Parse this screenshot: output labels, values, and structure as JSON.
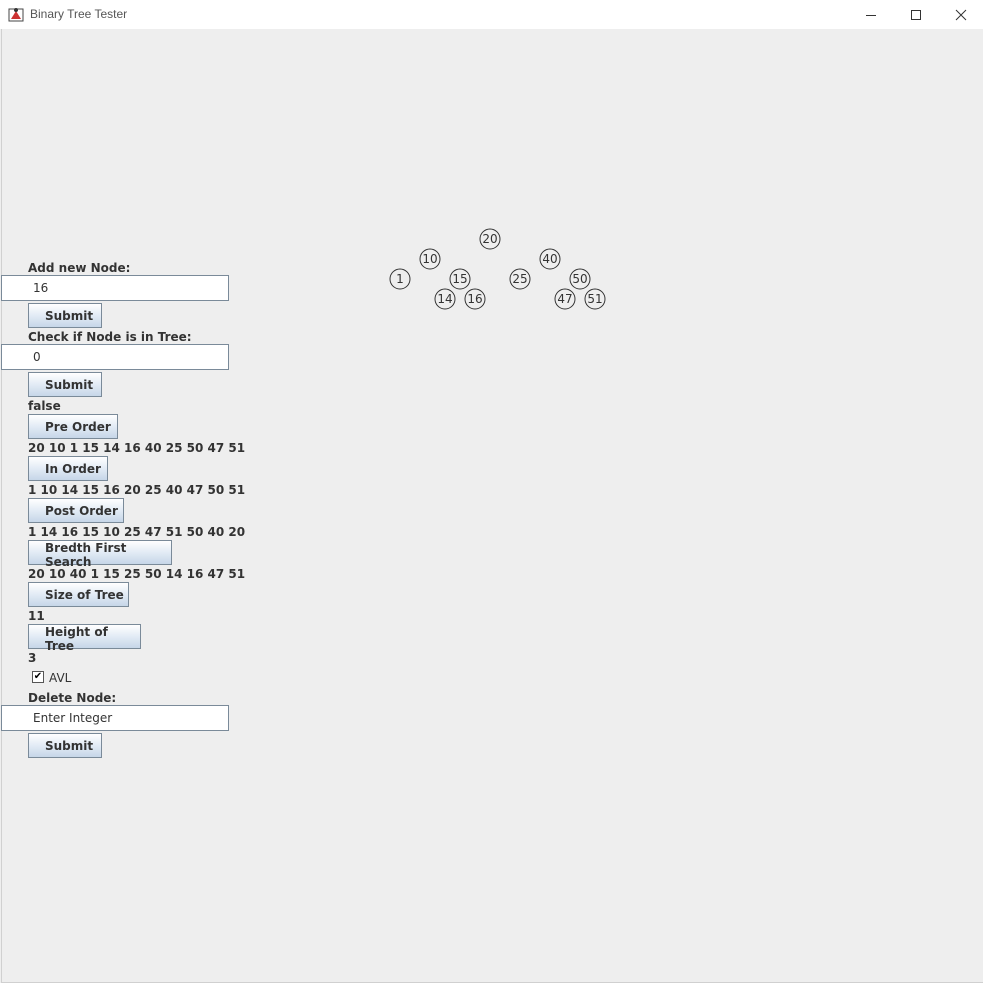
{
  "window": {
    "title": "Binary Tree Tester"
  },
  "add_node": {
    "label": "Add new Node:",
    "value": "16",
    "submit": "Submit"
  },
  "check_node": {
    "label": "Check if Node is in Tree:",
    "value": "0",
    "submit": "Submit",
    "result": "false"
  },
  "pre_order": {
    "button": "Pre Order",
    "result": "20 10 1 15 14 16 40 25 50 47 51"
  },
  "in_order": {
    "button": "In Order",
    "result": "1 10 14 15 16 20 25 40 47 50 51"
  },
  "post_order": {
    "button": "Post Order",
    "result": "1 14 16 15 10 25 47 51 50 40 20"
  },
  "bfs": {
    "button": "Bredth First Search",
    "result": "20 10 40 1 15 25 50 14 16 47 51"
  },
  "size": {
    "button": "Size of Tree",
    "result": "11"
  },
  "height": {
    "button": "Height of Tree",
    "result": "3"
  },
  "avl": {
    "label": "AVL",
    "checked": true
  },
  "delete_node": {
    "label": "Delete Node:",
    "placeholder": "Enter Integer",
    "value": "Enter Integer",
    "submit": "Submit"
  },
  "tree_nodes": [
    "20",
    "10",
    "40",
    "1",
    "15",
    "25",
    "50",
    "14",
    "16",
    "47",
    "51"
  ]
}
